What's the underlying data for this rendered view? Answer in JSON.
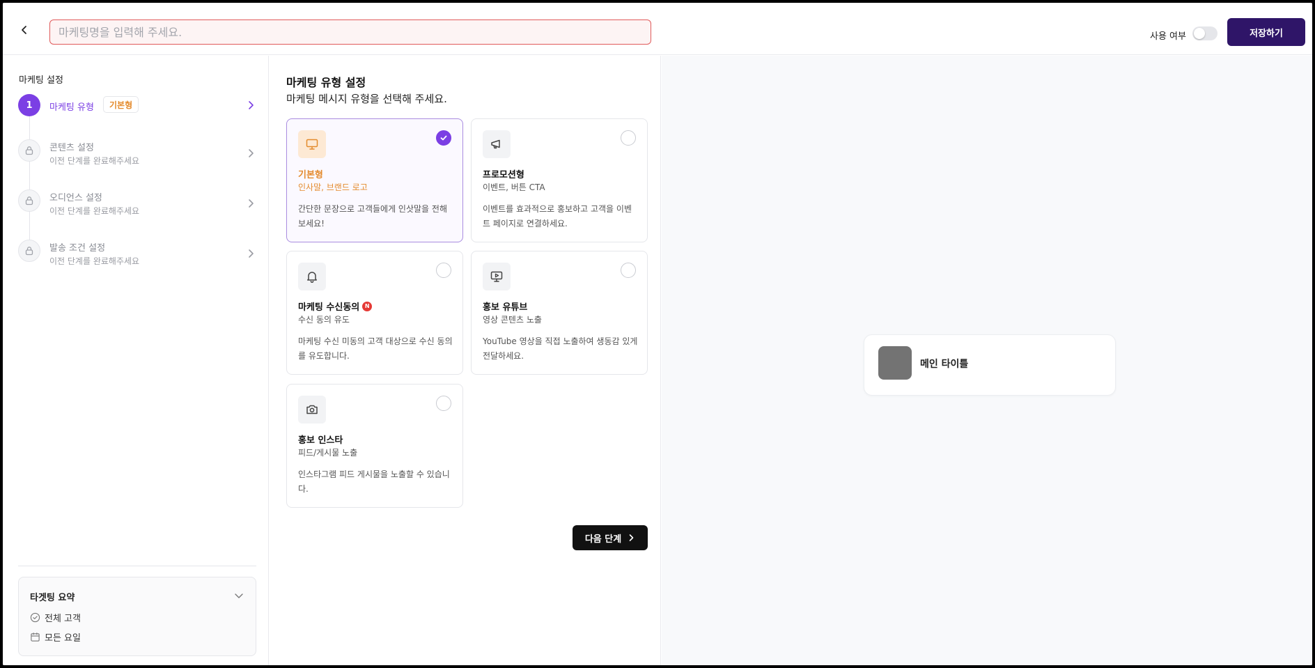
{
  "header": {
    "title_placeholder": "마케팅명을 입력해 주세요.",
    "title_value": "",
    "use_label": "사용 여부",
    "use_enabled": false,
    "save_label": "저장하기"
  },
  "sidebar": {
    "title": "마케팅 설정",
    "steps": [
      {
        "number": "1",
        "label": "마케팅 유형",
        "badge": "기본형",
        "status": "active"
      },
      {
        "label": "콘텐츠 설정",
        "sub": "이전 단계를 완료해주세요",
        "status": "locked"
      },
      {
        "label": "오디언스 설정",
        "sub": "이전 단계를 완료해주세요",
        "status": "locked"
      },
      {
        "label": "발송 조건 설정",
        "sub": "이전 단계를 완료해주세요",
        "status": "locked"
      }
    ],
    "summary": {
      "title": "타겟팅 요약",
      "items": [
        {
          "label": "전체 고객",
          "icon": "check-circle-icon"
        },
        {
          "label": "모든 요일",
          "icon": "calendar-icon"
        }
      ]
    }
  },
  "main": {
    "title": "마케팅 유형 설정",
    "subtitle": "마케팅 메시지 유형을 선택해 주세요.",
    "cards": [
      {
        "title": "기본형",
        "subtitle": "인사말, 브랜드 로고",
        "desc": "간단한 문장으로 고객들에게 인삿말을 전해보세요!",
        "icon": "monitor-icon",
        "selected": true
      },
      {
        "title": "프로모션형",
        "subtitle": "이벤트, 버튼 CTA",
        "desc": "이벤트를 효과적으로 홍보하고 고객을 이벤트 페이지로 연결하세요.",
        "icon": "megaphone-icon",
        "selected": false
      },
      {
        "title": "마케팅 수신동의",
        "badge": "N",
        "subtitle": "수신 동의 유도",
        "desc": "마케팅 수신 미동의 고객 대상으로 수신 동의를 유도합니다.",
        "icon": "bell-icon",
        "selected": false
      },
      {
        "title": "홍보 유튜브",
        "subtitle": "영상 콘텐츠 노출",
        "desc": "YouTube 영상을 직접 노출하여 생동감 있게 전달하세요.",
        "icon": "video-monitor-icon",
        "selected": false
      },
      {
        "title": "홍보 인스타",
        "subtitle": "피드/게시물 노출",
        "desc": "인스타그램 피드 게시물을 노출할 수 있습니다.",
        "icon": "camera-icon",
        "selected": false
      }
    ],
    "next_label": "다음 단계"
  },
  "preview": {
    "title": "메인 타이틀"
  },
  "colors": {
    "accent": "#7b3fe4",
    "brand_dark": "#2f1568",
    "orange": "#e48b2d",
    "error_border": "#e05a5a"
  }
}
